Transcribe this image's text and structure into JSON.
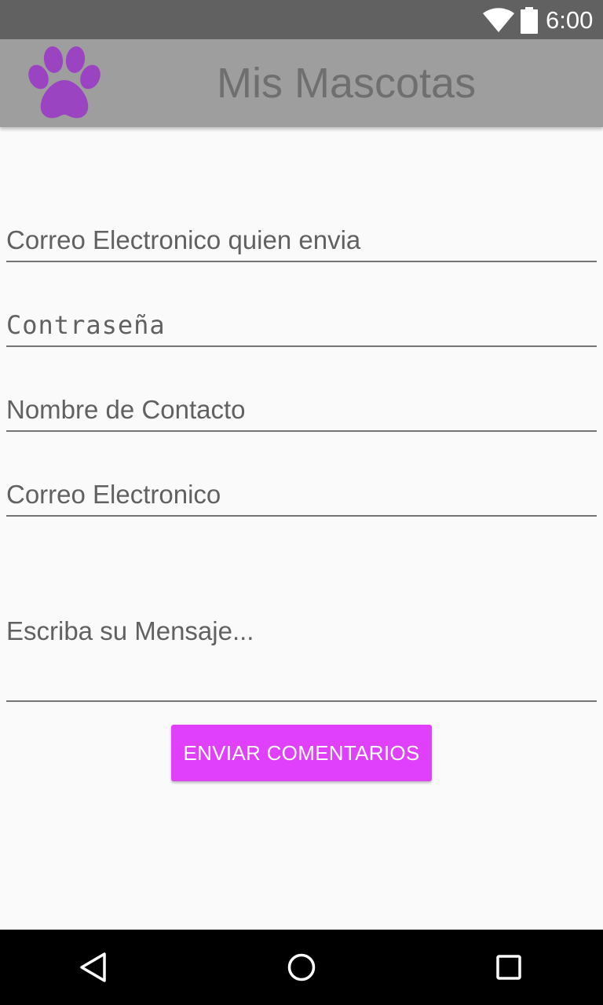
{
  "status_bar": {
    "time": "6:00",
    "icons": [
      "wifi-icon",
      "battery-icon"
    ]
  },
  "app_bar": {
    "title": "Mis Mascotas",
    "logo_icon": "paw-icon",
    "logo_color": "#8e44ad"
  },
  "form": {
    "sender_email_placeholder": "Correo Electronico quien envia",
    "password_placeholder": "Contraseña",
    "contact_name_placeholder": "Nombre de Contacto",
    "contact_email_placeholder": "Correo Electronico",
    "message_placeholder": "Escriba su Mensaje...",
    "submit_label": "ENVIAR COMENTARIOS"
  },
  "nav_bar": {
    "buttons": [
      "back-icon",
      "home-icon",
      "recents-icon"
    ]
  },
  "colors": {
    "status_bar": "#616161",
    "app_bar": "#9e9e9e",
    "accent_button": "#e040fb",
    "background": "#fafafa",
    "nav_bar": "#000000"
  }
}
